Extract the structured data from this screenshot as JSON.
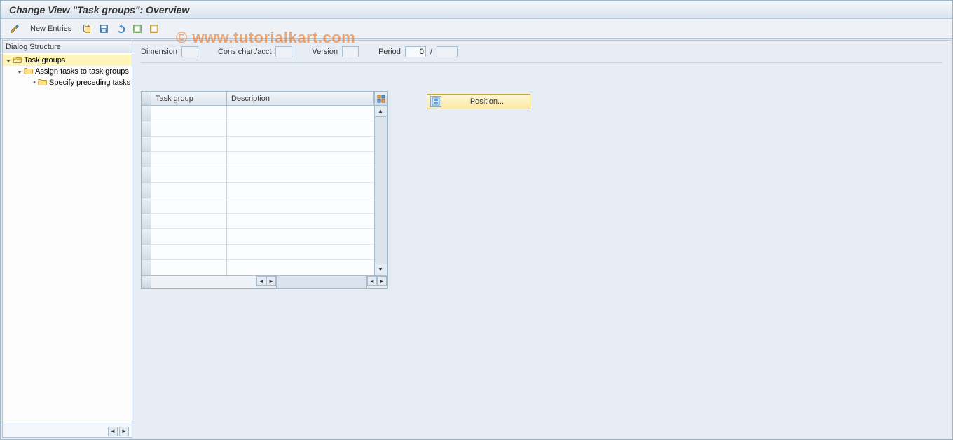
{
  "title": "Change View \"Task groups\": Overview",
  "watermark": "© www.tutorialkart.com",
  "toolbar": {
    "new_entries": "New Entries"
  },
  "sidebar": {
    "header": "Dialog Structure",
    "items": [
      {
        "label": "Task groups",
        "selected": true,
        "open": true,
        "icon": "folder-open"
      },
      {
        "label": "Assign tasks to task groups",
        "selected": false,
        "open": true,
        "icon": "folder",
        "indent": 1
      },
      {
        "label": "Specify preceding tasks",
        "selected": false,
        "open": false,
        "icon": "folder",
        "indent": 2,
        "bullet": true
      }
    ]
  },
  "filters": {
    "dimension_label": "Dimension",
    "dimension_value": "",
    "cons_label": "Cons chart/acct",
    "cons_value": "",
    "version_label": "Version",
    "version_value": "",
    "period_label": "Period",
    "period_value1": "0",
    "period_sep": "/",
    "period_value2": ""
  },
  "table": {
    "columns": {
      "taskgroup": "Task group",
      "description": "Description"
    },
    "rows": 11
  },
  "position_button": {
    "label": "Position..."
  }
}
